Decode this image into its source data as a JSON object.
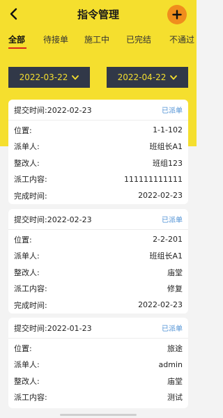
{
  "header": {
    "title": "指令管理",
    "back_icon": "chevron-left-icon",
    "add_icon": "plus-icon",
    "accent": "#f5df2e",
    "add_color": "#f08d1d"
  },
  "tabs": [
    {
      "label": "全部",
      "active": true
    },
    {
      "label": "待接单",
      "active": false
    },
    {
      "label": "施工中",
      "active": false
    },
    {
      "label": "已完结",
      "active": false
    },
    {
      "label": "不通过",
      "active": false
    }
  ],
  "filters": {
    "start_date": "2022-03-22",
    "end_date": "2022-04-22"
  },
  "labels": {
    "location": "位置:",
    "dispatcher": "派单人:",
    "rectifier": "整改人:",
    "content": "派工内容:",
    "completed": "完成时间:"
  },
  "cards": [
    {
      "submit": "提交时间:2022-02-23",
      "status": "已派单",
      "location": "1-1-102",
      "dispatcher": "班组长A1",
      "rectifier": "班组123",
      "content": "111111111111",
      "completed": "2022-02-23"
    },
    {
      "submit": "提交时间:2022-02-23",
      "status": "已派单",
      "location": "2-2-201",
      "dispatcher": "班组长A1",
      "rectifier": "庙堂",
      "content": "修复",
      "completed": "2022-02-23"
    },
    {
      "submit": "提交时间:2022-01-23",
      "status": "已派单",
      "location": "旅途",
      "dispatcher": "admin",
      "rectifier": "庙堂",
      "content": "测试"
    }
  ]
}
